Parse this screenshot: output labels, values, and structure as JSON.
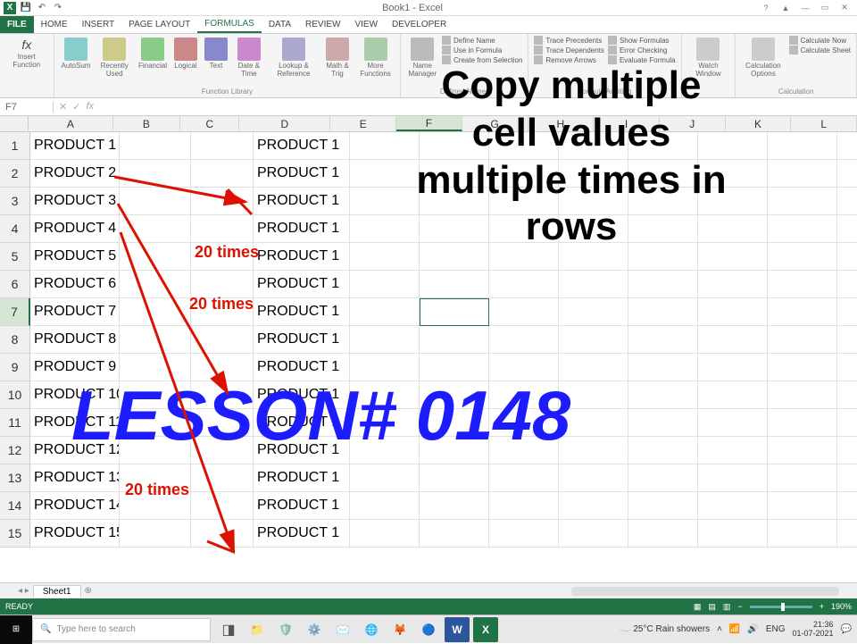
{
  "app": {
    "title": "Book1 - Excel"
  },
  "qat": {
    "save": "💾",
    "undo": "↶",
    "redo": "↷"
  },
  "win": {
    "min": "—",
    "restore": "▭",
    "close": "✕"
  },
  "tabs": {
    "file": "FILE",
    "home": "HOME",
    "insert": "INSERT",
    "page_layout": "PAGE LAYOUT",
    "formulas": "FORMULAS",
    "data": "DATA",
    "review": "REVIEW",
    "view": "VIEW",
    "developer": "DEVELOPER"
  },
  "ribbon": {
    "insert_function": "Insert\nFunction",
    "autosum": "AutoSum",
    "recently": "Recently\nUsed",
    "financial": "Financial",
    "logical": "Logical",
    "text": "Text",
    "date": "Date &\nTime",
    "lookup": "Lookup &\nReference",
    "math": "Math &\nTrig",
    "more": "More\nFunctions",
    "group_funclib": "Function Library",
    "name_mgr": "Name\nManager",
    "define_name": "Define Name",
    "use_formula": "Use in Formula",
    "create_sel": "Create from Selection",
    "group_names": "Defined Names",
    "trace_prec": "Trace Precedents",
    "trace_dep": "Trace Dependents",
    "remove_arrows": "Remove Arrows",
    "show_formulas": "Show Formulas",
    "error_check": "Error Checking",
    "eval_formula": "Evaluate Formula",
    "group_audit": "Formula Auditing",
    "watch": "Watch\nWindow",
    "calc_options": "Calculation\nOptions",
    "calc_now": "Calculate Now",
    "calc_sheet": "Calculate Sheet",
    "group_calc": "Calculation"
  },
  "name_box": "F7",
  "fx": {
    "cancel": "✕",
    "enter": "✓",
    "label": "fx"
  },
  "columns": [
    "A",
    "B",
    "C",
    "D",
    "E",
    "F",
    "G",
    "H",
    "I",
    "J",
    "K",
    "L"
  ],
  "rows": [
    "1",
    "2",
    "3",
    "4",
    "5",
    "6",
    "7",
    "8",
    "9",
    "10",
    "11",
    "12",
    "13",
    "14",
    "15"
  ],
  "colA": [
    "PRODUCT 1",
    "PRODUCT 2",
    "PRODUCT 3",
    "PRODUCT 4",
    "PRODUCT 5",
    "PRODUCT 6",
    "PRODUCT 7",
    "PRODUCT 8",
    "PRODUCT 9",
    "PRODUCT 10",
    "PRODUCT 11",
    "PRODUCT 12",
    "PRODUCT 13",
    "PRODUCT 14",
    "PRODUCT 15"
  ],
  "colD": [
    "PRODUCT 1",
    "PRODUCT 1",
    "PRODUCT 1",
    "PRODUCT 1",
    "PRODUCT 1",
    "PRODUCT 1",
    "PRODUCT 1",
    "PRODUCT 1",
    "PRODUCT 1",
    "PRODUCT 1",
    "PRODUCT 1",
    "PRODUCT 1",
    "PRODUCT 1",
    "PRODUCT 1",
    "PRODUCT 1"
  ],
  "annotations": {
    "title_line1": "Copy multiple",
    "title_line2": "cell values",
    "title_line3": "multiple times in",
    "title_line4": "rows",
    "lesson": "LESSON# 0148",
    "times1": "20 times",
    "times2": "20 times",
    "times3": "20 times"
  },
  "sheet": {
    "name": "Sheet1",
    "add": "⊕"
  },
  "status": {
    "ready": "READY",
    "zoom": "190%"
  },
  "taskbar": {
    "search_placeholder": "Type here to search",
    "weather": "25°C Rain showers",
    "lang": "ENG",
    "time": "21:36",
    "date": "01-07-2021"
  }
}
